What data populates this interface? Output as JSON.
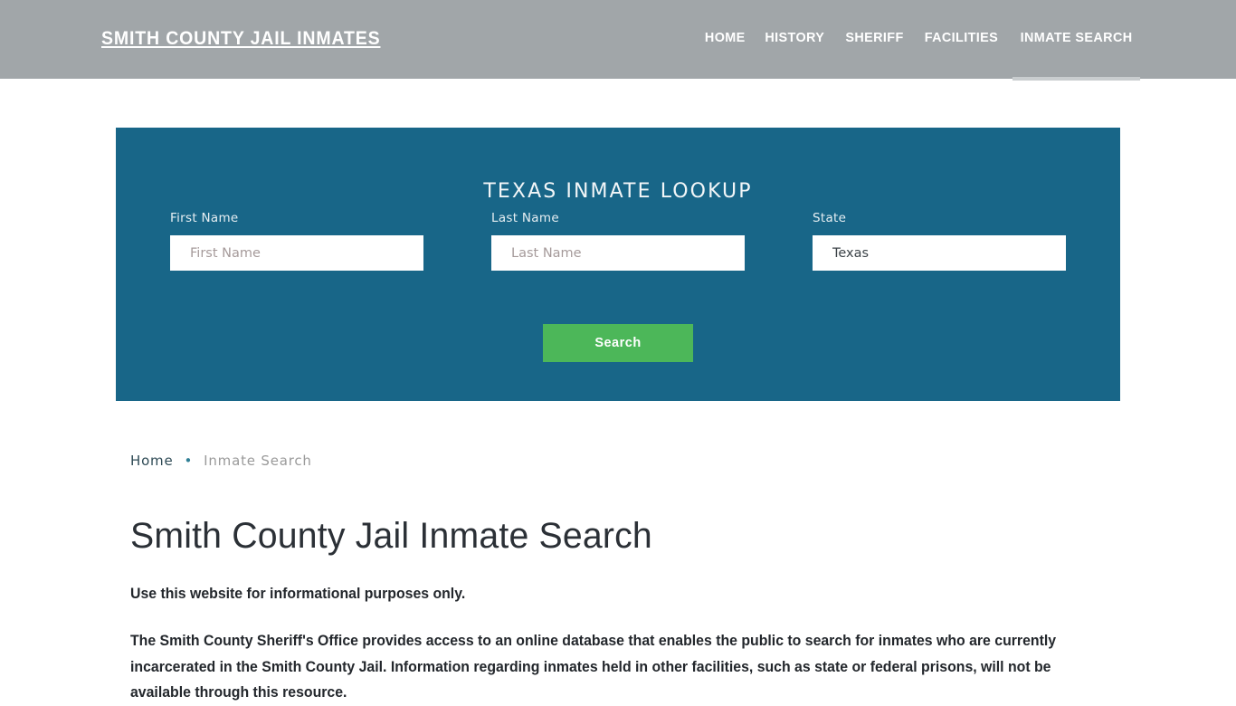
{
  "header": {
    "brand": "Smith County Jail Inmates",
    "nav": [
      {
        "label": "HOME",
        "active": false
      },
      {
        "label": "HISTORY",
        "active": false
      },
      {
        "label": "SHERIFF",
        "active": false
      },
      {
        "label": "FACILITIES",
        "active": false
      },
      {
        "label": "INMATE SEARCH",
        "active": true
      }
    ],
    "background_color": "#a1a6a9",
    "active_indicator_color": "#c9cdcf"
  },
  "lookup": {
    "title": "TEXAS INMATE LOOKUP",
    "panel_color": "#186688",
    "fields": {
      "first_name": {
        "label": "First Name",
        "placeholder": "First Name",
        "value": ""
      },
      "last_name": {
        "label": "Last Name",
        "placeholder": "Last Name",
        "value": ""
      },
      "state": {
        "label": "State",
        "value": "Texas",
        "options": [
          "Texas"
        ]
      }
    },
    "search_button": {
      "label": "Search",
      "color": "#4cb759"
    }
  },
  "breadcrumb": {
    "home": "Home",
    "separator": "•",
    "current": "Inmate Search"
  },
  "main": {
    "title": "Smith County Jail Inmate Search",
    "lead": "Use this website for informational purposes only.",
    "paragraph": "The Smith County Sheriff's Office provides access to an online database that enables the public to search for inmates who are currently incarcerated in the Smith County Jail. Information regarding inmates held in other facilities, such as state or federal prisons, will not be available through this resource."
  }
}
